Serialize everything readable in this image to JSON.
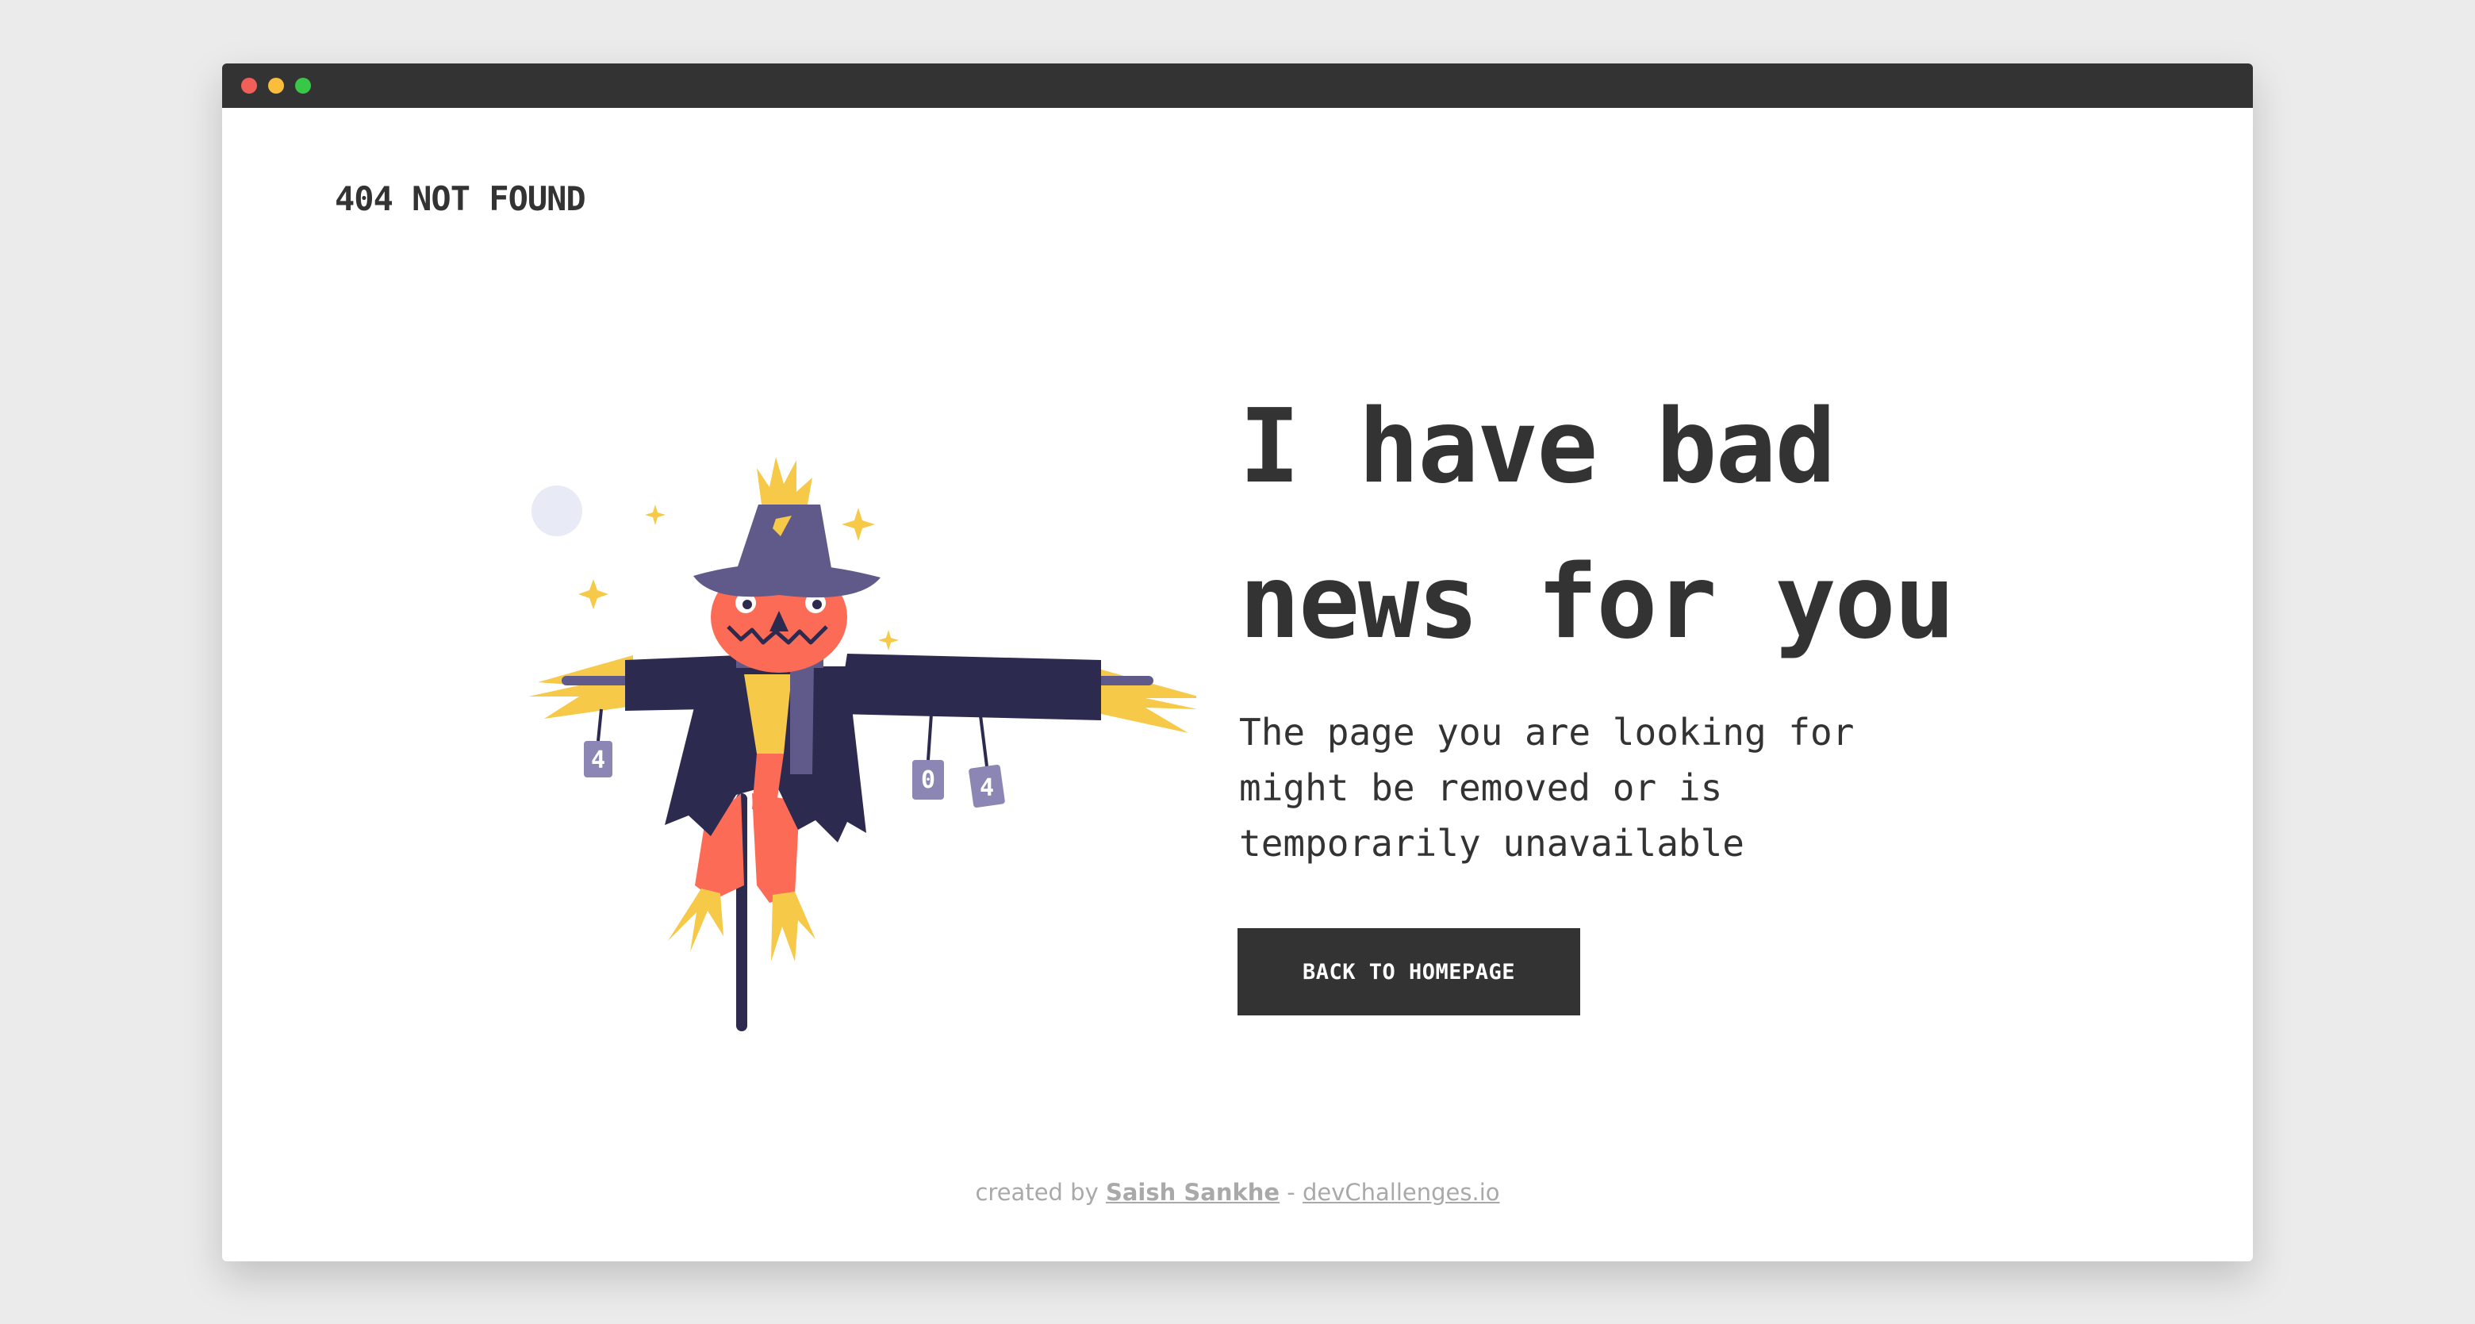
{
  "window": {
    "traffic_lights": [
      "#f25f58",
      "#fbbe3c",
      "#39c748"
    ],
    "titlebar_color": "#333333"
  },
  "header": {
    "logo": "404 NOT FOUND"
  },
  "illustration": {
    "icon": "scarecrow-illustration",
    "cans": [
      "4",
      "0",
      "4"
    ]
  },
  "main": {
    "headline": "I have bad news for you",
    "message": "The page you are looking for might be removed or is temporarily unavailable",
    "button_label": "BACK TO HOMEPAGE"
  },
  "footer": {
    "prefix": "created by",
    "author": "Saish Sankhe",
    "separator": "-",
    "site": "devChallenges.io"
  },
  "colors": {
    "text": "#333333",
    "button_bg": "#333333",
    "button_text": "#ffffff",
    "footer_text": "#a9a9a9",
    "straw": "#f7c948",
    "hat": "#5f5a8a",
    "coat": "#2c2a4e",
    "face": "#fb6b56",
    "moon": "#e8ebf6"
  }
}
